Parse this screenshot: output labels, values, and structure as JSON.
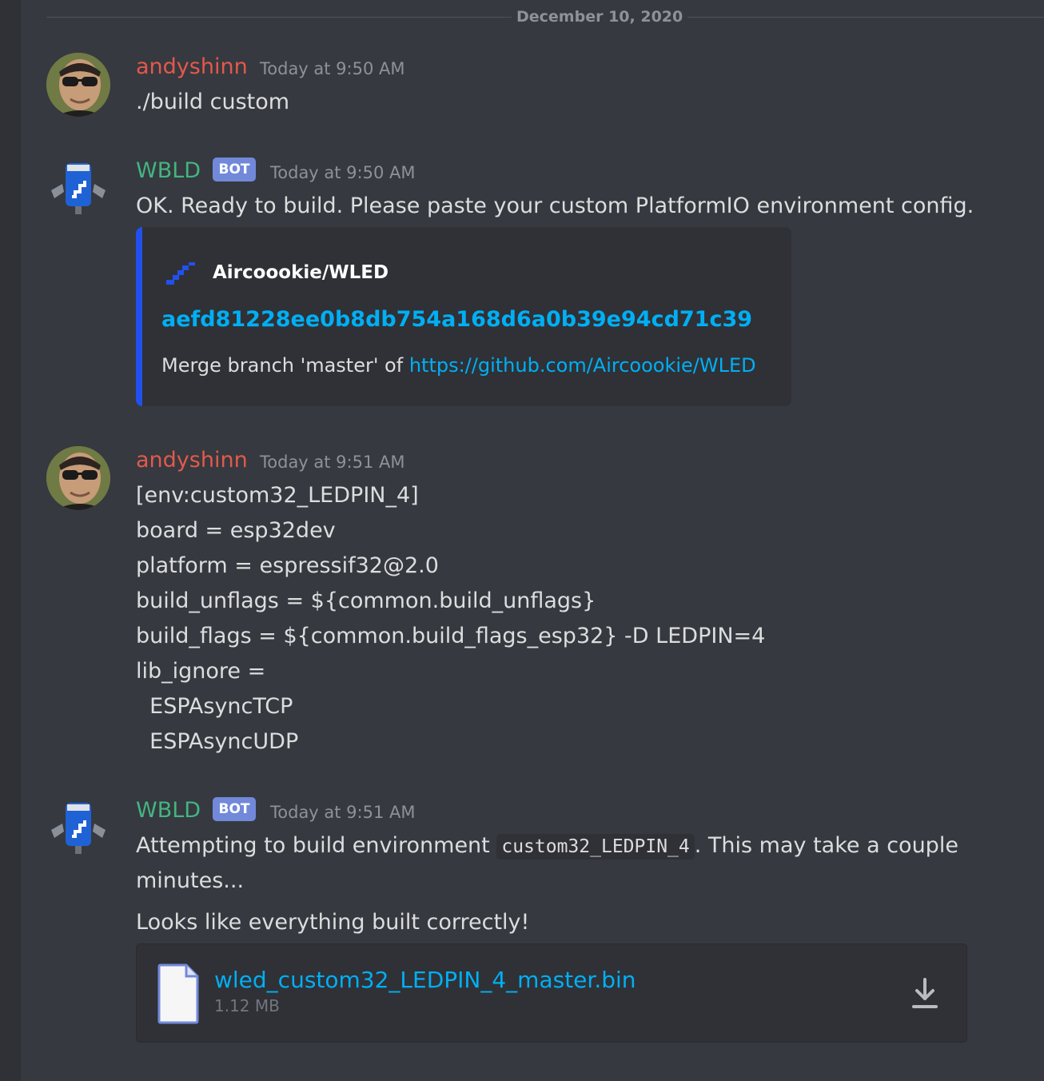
{
  "divider": {
    "date": "December 10, 2020"
  },
  "messages": [
    {
      "author": "andyshinn",
      "timestamp": "Today at 9:50 AM",
      "text": "./build custom"
    },
    {
      "author": "WBLD",
      "badge": "BOT",
      "timestamp": "Today at 9:50 AM",
      "text": "OK. Ready to build. Please paste your custom PlatformIO environment config.",
      "embed": {
        "author": "Aircoookie/WLED",
        "title": "aefd81228ee0b8db754a168d6a0b39e94cd71c39",
        "description_prefix": "Merge branch 'master' of ",
        "description_link": "https://github.com/Aircoookie/WLED",
        "accent_color": "#2150ef"
      }
    },
    {
      "author": "andyshinn",
      "timestamp": "Today at 9:51 AM",
      "lines": [
        "[env:custom32_LEDPIN_4]",
        "board = esp32dev",
        "platform = espressif32@2.0",
        "build_unflags = ${common.build_unflags}",
        "build_flags = ${common.build_flags_esp32} -D LEDPIN=4",
        "lib_ignore =",
        "  ESPAsyncTCP",
        "  ESPAsyncUDP"
      ]
    },
    {
      "author": "WBLD",
      "badge": "BOT",
      "timestamp": "Today at 9:51 AM",
      "text_prefix": "Attempting to build environment ",
      "code": "custom32_LEDPIN_4",
      "text_suffix": ". This may take a couple",
      "text_line2": "minutes...",
      "followup": "Looks like everything built correctly!",
      "attachment": {
        "filename": "wled_custom32_LEDPIN_4_master.bin",
        "size": "1.12 MB"
      }
    }
  ],
  "colors": {
    "background": "#36393f",
    "user_name": "#e3594b",
    "bot_name": "#43b581",
    "link": "#00aff4",
    "badge": "#7289da"
  },
  "icons": {
    "user_avatar": "user-photo-avatar",
    "bot_avatar": "wled-robot-avatar",
    "file": "file-icon",
    "download": "download-icon"
  }
}
